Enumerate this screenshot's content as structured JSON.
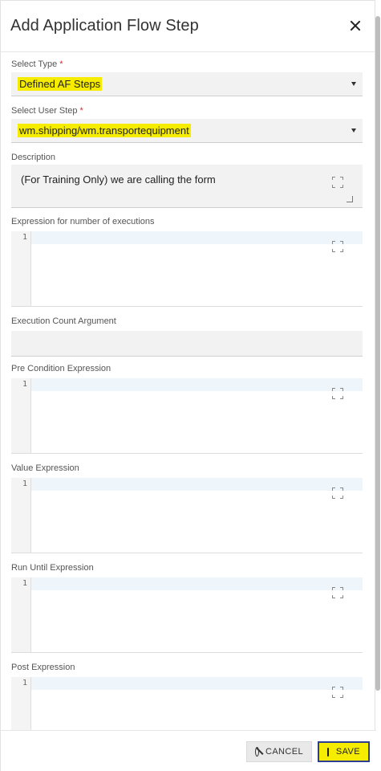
{
  "dialog": {
    "title": "Add Application Flow Step"
  },
  "fields": {
    "select_type": {
      "label": "Select Type",
      "required_mark": "*",
      "value": "Defined AF Steps"
    },
    "select_user_step": {
      "label": "Select User Step",
      "required_mark": "*",
      "value": "wm.shipping/wm.transportequipment"
    },
    "description": {
      "label": "Description",
      "value": "(For Training Only) we are calling the form"
    },
    "expression_executions": {
      "label": "Expression for number of executions",
      "line_number": "1"
    },
    "execution_count_argument": {
      "label": "Execution Count Argument",
      "value": ""
    },
    "pre_condition": {
      "label": "Pre Condition Expression",
      "line_number": "1"
    },
    "value_expression": {
      "label": "Value Expression",
      "line_number": "1"
    },
    "run_until": {
      "label": "Run Until Expression",
      "line_number": "1"
    },
    "post_expression": {
      "label": "Post Expression",
      "line_number": "1"
    }
  },
  "footer": {
    "cancel_label": "CANCEL",
    "save_label": "SAVE"
  },
  "colors": {
    "highlight": "#f5ec00",
    "required": "#d32f2f",
    "save_border": "#2e3c91"
  }
}
